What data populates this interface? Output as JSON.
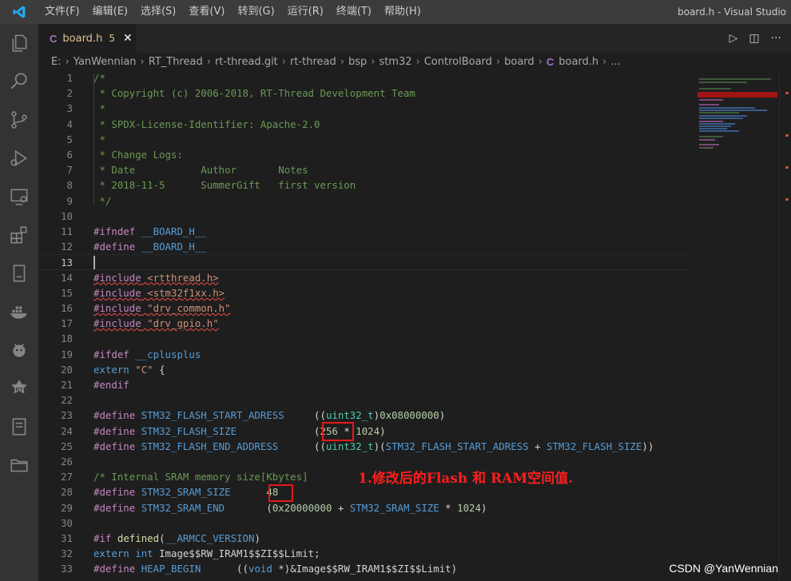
{
  "titlebar": {
    "menus": [
      "文件(F)",
      "编辑(E)",
      "选择(S)",
      "查看(V)",
      "转到(G)",
      "运行(R)",
      "终端(T)",
      "帮助(H)"
    ],
    "window_title": "board.h - Visual Studio"
  },
  "activitybar": {
    "icons": [
      "explorer-icon",
      "search-icon",
      "source-control-icon",
      "run-debug-icon",
      "remote-explorer-icon",
      "extensions-icon",
      "device-icon",
      "docker-icon",
      "android-icon",
      "rt-thread-icon",
      "notes-icon",
      "folder-icon"
    ]
  },
  "tab": {
    "icon_label": "C",
    "filename": "board.h",
    "problems_count": "5",
    "close_glyph": "✕"
  },
  "tab_actions": {
    "run_glyph": "▷",
    "split_glyph": "◫",
    "more_glyph": "···"
  },
  "breadcrumb": [
    "E:",
    "YanWennian",
    "RT_Thread",
    "rt-thread.git",
    "rt-thread",
    "bsp",
    "stm32",
    "ControlBoard",
    "board"
  ],
  "breadcrumb_file": {
    "icon_label": "C",
    "name": "board.h",
    "tail": "..."
  },
  "editor": {
    "active_line": 13,
    "lines": [
      {
        "n": 1,
        "tokens": [
          [
            "cm",
            "/*"
          ]
        ]
      },
      {
        "n": 2,
        "tokens": [
          [
            "cm",
            " * Copyright (c) 2006-2018, RT-Thread Development Team"
          ]
        ]
      },
      {
        "n": 3,
        "tokens": [
          [
            "cm",
            " *"
          ]
        ]
      },
      {
        "n": 4,
        "tokens": [
          [
            "cm",
            " * SPDX-License-Identifier: Apache-2.0"
          ]
        ]
      },
      {
        "n": 5,
        "tokens": [
          [
            "cm",
            " *"
          ]
        ]
      },
      {
        "n": 6,
        "tokens": [
          [
            "cm",
            " * Change Logs:"
          ]
        ]
      },
      {
        "n": 7,
        "tokens": [
          [
            "cm",
            " * Date           Author       Notes"
          ]
        ]
      },
      {
        "n": 8,
        "tokens": [
          [
            "cm",
            " * 2018-11-5      SummerGift   first version"
          ]
        ]
      },
      {
        "n": 9,
        "tokens": [
          [
            "cm",
            " */"
          ]
        ]
      },
      {
        "n": 10,
        "tokens": []
      },
      {
        "n": 11,
        "tokens": [
          [
            "kw",
            "#ifndef"
          ],
          [
            "pl",
            " "
          ],
          [
            "mac",
            "__BOARD_H__"
          ]
        ]
      },
      {
        "n": 12,
        "tokens": [
          [
            "kw",
            "#define"
          ],
          [
            "pl",
            " "
          ],
          [
            "mac",
            "__BOARD_H__"
          ]
        ]
      },
      {
        "n": 13,
        "tokens": []
      },
      {
        "n": 14,
        "tokens": [
          [
            "kw squig",
            "#include"
          ],
          [
            "pl squig",
            " "
          ],
          [
            "str squig",
            "<rtthread.h>"
          ]
        ]
      },
      {
        "n": 15,
        "tokens": [
          [
            "kw squig",
            "#include"
          ],
          [
            "pl squig",
            " "
          ],
          [
            "str squig",
            "<stm32f1xx.h>"
          ]
        ]
      },
      {
        "n": 16,
        "tokens": [
          [
            "kw squig",
            "#include"
          ],
          [
            "pl squig",
            " "
          ],
          [
            "str squig",
            "\"drv_common.h\""
          ]
        ]
      },
      {
        "n": 17,
        "tokens": [
          [
            "kw squig",
            "#include"
          ],
          [
            "pl squig",
            " "
          ],
          [
            "str squig",
            "\"drv_gpio.h\""
          ]
        ]
      },
      {
        "n": 18,
        "tokens": []
      },
      {
        "n": 19,
        "tokens": [
          [
            "kw",
            "#ifdef"
          ],
          [
            "pl",
            " "
          ],
          [
            "mac",
            "__cplusplus"
          ]
        ]
      },
      {
        "n": 20,
        "tokens": [
          [
            "kb",
            "extern"
          ],
          [
            "pl",
            " "
          ],
          [
            "str",
            "\"C\""
          ],
          [
            "pl",
            " {"
          ]
        ]
      },
      {
        "n": 21,
        "tokens": [
          [
            "kw",
            "#endif"
          ]
        ]
      },
      {
        "n": 22,
        "tokens": []
      },
      {
        "n": 23,
        "tokens": [
          [
            "kw",
            "#define"
          ],
          [
            "pl",
            " "
          ],
          [
            "mac",
            "STM32_FLASH_START_ADRESS"
          ],
          [
            "pl",
            "     (("
          ],
          [
            "ty",
            "uint32_t"
          ],
          [
            "pl",
            ")"
          ],
          [
            "num",
            "0x08000000"
          ],
          [
            "pl",
            ")"
          ]
        ]
      },
      {
        "n": 24,
        "tokens": [
          [
            "kw",
            "#define"
          ],
          [
            "pl",
            " "
          ],
          [
            "mac",
            "STM32_FLASH_SIZE"
          ],
          [
            "pl",
            "             ("
          ],
          [
            "num",
            "256"
          ],
          [
            "pl",
            " * "
          ],
          [
            "num",
            "1024"
          ],
          [
            "pl",
            ")"
          ]
        ]
      },
      {
        "n": 25,
        "tokens": [
          [
            "kw",
            "#define"
          ],
          [
            "pl",
            " "
          ],
          [
            "mac",
            "STM32_FLASH_END_ADDRESS"
          ],
          [
            "pl",
            "      (("
          ],
          [
            "ty",
            "uint32_t"
          ],
          [
            "pl",
            ")("
          ],
          [
            "mac",
            "STM32_FLASH_START_ADRESS"
          ],
          [
            "pl",
            " + "
          ],
          [
            "mac",
            "STM32_FLASH_SIZE"
          ],
          [
            "pl",
            "))"
          ]
        ]
      },
      {
        "n": 26,
        "tokens": []
      },
      {
        "n": 27,
        "tokens": [
          [
            "cm",
            "/* Internal SRAM memory size[Kbytes]"
          ]
        ]
      },
      {
        "n": 28,
        "tokens": [
          [
            "kw",
            "#define"
          ],
          [
            "pl",
            " "
          ],
          [
            "mac",
            "STM32_SRAM_SIZE"
          ],
          [
            "pl",
            "      "
          ],
          [
            "num",
            "48"
          ]
        ]
      },
      {
        "n": 29,
        "tokens": [
          [
            "kw",
            "#define"
          ],
          [
            "pl",
            " "
          ],
          [
            "mac",
            "STM32_SRAM_END"
          ],
          [
            "pl",
            "       ("
          ],
          [
            "num",
            "0x20000000"
          ],
          [
            "pl",
            " + "
          ],
          [
            "mac",
            "STM32_SRAM_SIZE"
          ],
          [
            "pl",
            " * "
          ],
          [
            "num",
            "1024"
          ],
          [
            "pl",
            ")"
          ]
        ]
      },
      {
        "n": 30,
        "tokens": []
      },
      {
        "n": 31,
        "tokens": [
          [
            "kw",
            "#if"
          ],
          [
            "pl",
            " "
          ],
          [
            "fn",
            "defined"
          ],
          [
            "pl",
            "("
          ],
          [
            "mac",
            "__ARMCC_VERSION"
          ],
          [
            "pl",
            ")"
          ]
        ]
      },
      {
        "n": 32,
        "tokens": [
          [
            "kb",
            "extern"
          ],
          [
            "pl",
            " "
          ],
          [
            "kb",
            "int"
          ],
          [
            "pl",
            " Image$$RW_IRAM1$$ZI$$Limit;"
          ]
        ]
      },
      {
        "n": 33,
        "tokens": [
          [
            "kw",
            "#define"
          ],
          [
            "pl",
            " "
          ],
          [
            "mac",
            "HEAP_BEGIN"
          ],
          [
            "pl",
            "      (("
          ],
          [
            "kb",
            "void"
          ],
          [
            "pl",
            " *)&Image$$RW_IRAM1$$ZI$$Limit)"
          ]
        ]
      }
    ]
  },
  "annotation": "1.修改后的Flash 和 RAM空间值.",
  "watermark": "CSDN @YanWennian",
  "colors": {
    "accent_red": "#e51a1a",
    "comment": "#6a9955",
    "preprocessor": "#c586c0",
    "macro": "#569cd6",
    "number": "#b5cea8",
    "string": "#ce9178",
    "type": "#4ec9b0"
  }
}
